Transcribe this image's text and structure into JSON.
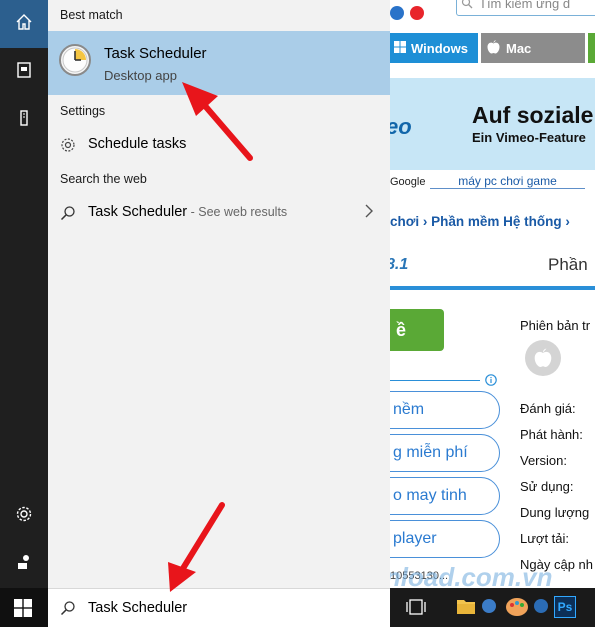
{
  "search_panel": {
    "best_match_title": "Best match",
    "best_match": {
      "name": "Task Scheduler",
      "type": "Desktop app"
    },
    "settings_title": "Settings",
    "settings_item": "Schedule tasks",
    "web_title": "Search the web",
    "web_item": "Task Scheduler",
    "web_item_suffix": " - See web results"
  },
  "search_box": {
    "value": "Task Scheduler"
  },
  "website": {
    "search_placeholder": "Tìm kiếm ứng d",
    "nav_tabs": [
      "Windows",
      "Mac"
    ],
    "banner_line1": "Auf soziale",
    "banner_line2": "Ein Vimeo-Feature",
    "banner_logo": "eo",
    "google_label": "Google",
    "google_link": "máy pc chơi game",
    "breadcrumb": "chơi  ›  Phần mềm Hệ thống  ›",
    "version_text": "8.1",
    "phan_text": "Phần",
    "download_label": "ề",
    "pills": [
      "nềm",
      "g miễn phí",
      "o may tinh",
      "player"
    ],
    "info_labels": [
      "Phiên bản tr",
      "Đánh giá:",
      "Phát hành:",
      "Version:",
      "Sử dụng:",
      "Dung lượng",
      "Lượt tải:",
      "Ngày cập nh"
    ],
    "watermark": "Download.com.vn",
    "code_text": "10553130..."
  },
  "colors": {
    "rail_bg": "#1f1f1f",
    "panel_bg": "#f2f2f2",
    "highlight": "#aacde8",
    "arrow": "#e8151b",
    "windows_tab": "#1e8fd6",
    "mac_tab": "#8c8c8c"
  }
}
